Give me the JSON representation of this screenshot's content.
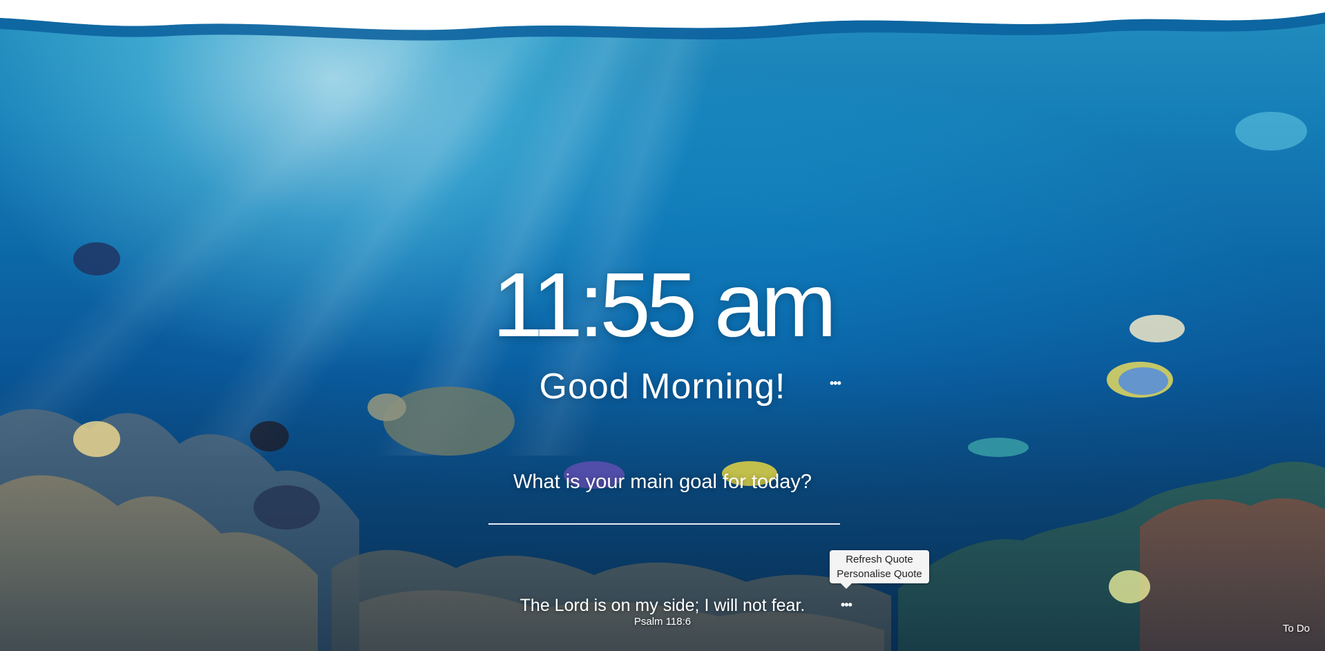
{
  "clock": {
    "time": "11:55 am"
  },
  "greeting": {
    "text": "Good Morning!",
    "more_label": "•••"
  },
  "focus": {
    "question": "What is your main goal for today?",
    "value": "",
    "placeholder": ""
  },
  "quote_menu": {
    "items": [
      {
        "label": "Refresh Quote"
      },
      {
        "label": "Personalise Quote"
      }
    ]
  },
  "quote": {
    "text": "The Lord is on my side; I will not fear.",
    "source": "Psalm 118:6",
    "more_label": "•••"
  },
  "todo": {
    "label": "To Do"
  },
  "colors": {
    "text": "#ffffff",
    "menu_background": "#f4f4f4",
    "menu_text": "#222222"
  }
}
